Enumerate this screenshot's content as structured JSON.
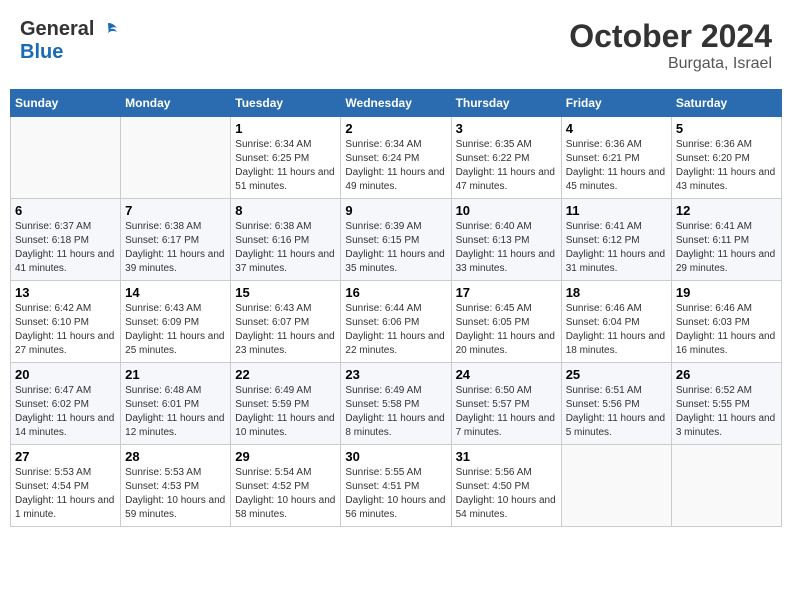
{
  "header": {
    "logo_general": "General",
    "logo_blue": "Blue",
    "month_title": "October 2024",
    "subtitle": "Burgata, Israel"
  },
  "days_of_week": [
    "Sunday",
    "Monday",
    "Tuesday",
    "Wednesday",
    "Thursday",
    "Friday",
    "Saturday"
  ],
  "weeks": [
    [
      {
        "day": "",
        "info": ""
      },
      {
        "day": "",
        "info": ""
      },
      {
        "day": "1",
        "info": "Sunrise: 6:34 AM\nSunset: 6:25 PM\nDaylight: 11 hours and 51 minutes."
      },
      {
        "day": "2",
        "info": "Sunrise: 6:34 AM\nSunset: 6:24 PM\nDaylight: 11 hours and 49 minutes."
      },
      {
        "day": "3",
        "info": "Sunrise: 6:35 AM\nSunset: 6:22 PM\nDaylight: 11 hours and 47 minutes."
      },
      {
        "day": "4",
        "info": "Sunrise: 6:36 AM\nSunset: 6:21 PM\nDaylight: 11 hours and 45 minutes."
      },
      {
        "day": "5",
        "info": "Sunrise: 6:36 AM\nSunset: 6:20 PM\nDaylight: 11 hours and 43 minutes."
      }
    ],
    [
      {
        "day": "6",
        "info": "Sunrise: 6:37 AM\nSunset: 6:18 PM\nDaylight: 11 hours and 41 minutes."
      },
      {
        "day": "7",
        "info": "Sunrise: 6:38 AM\nSunset: 6:17 PM\nDaylight: 11 hours and 39 minutes."
      },
      {
        "day": "8",
        "info": "Sunrise: 6:38 AM\nSunset: 6:16 PM\nDaylight: 11 hours and 37 minutes."
      },
      {
        "day": "9",
        "info": "Sunrise: 6:39 AM\nSunset: 6:15 PM\nDaylight: 11 hours and 35 minutes."
      },
      {
        "day": "10",
        "info": "Sunrise: 6:40 AM\nSunset: 6:13 PM\nDaylight: 11 hours and 33 minutes."
      },
      {
        "day": "11",
        "info": "Sunrise: 6:41 AM\nSunset: 6:12 PM\nDaylight: 11 hours and 31 minutes."
      },
      {
        "day": "12",
        "info": "Sunrise: 6:41 AM\nSunset: 6:11 PM\nDaylight: 11 hours and 29 minutes."
      }
    ],
    [
      {
        "day": "13",
        "info": "Sunrise: 6:42 AM\nSunset: 6:10 PM\nDaylight: 11 hours and 27 minutes."
      },
      {
        "day": "14",
        "info": "Sunrise: 6:43 AM\nSunset: 6:09 PM\nDaylight: 11 hours and 25 minutes."
      },
      {
        "day": "15",
        "info": "Sunrise: 6:43 AM\nSunset: 6:07 PM\nDaylight: 11 hours and 23 minutes."
      },
      {
        "day": "16",
        "info": "Sunrise: 6:44 AM\nSunset: 6:06 PM\nDaylight: 11 hours and 22 minutes."
      },
      {
        "day": "17",
        "info": "Sunrise: 6:45 AM\nSunset: 6:05 PM\nDaylight: 11 hours and 20 minutes."
      },
      {
        "day": "18",
        "info": "Sunrise: 6:46 AM\nSunset: 6:04 PM\nDaylight: 11 hours and 18 minutes."
      },
      {
        "day": "19",
        "info": "Sunrise: 6:46 AM\nSunset: 6:03 PM\nDaylight: 11 hours and 16 minutes."
      }
    ],
    [
      {
        "day": "20",
        "info": "Sunrise: 6:47 AM\nSunset: 6:02 PM\nDaylight: 11 hours and 14 minutes."
      },
      {
        "day": "21",
        "info": "Sunrise: 6:48 AM\nSunset: 6:01 PM\nDaylight: 11 hours and 12 minutes."
      },
      {
        "day": "22",
        "info": "Sunrise: 6:49 AM\nSunset: 5:59 PM\nDaylight: 11 hours and 10 minutes."
      },
      {
        "day": "23",
        "info": "Sunrise: 6:49 AM\nSunset: 5:58 PM\nDaylight: 11 hours and 8 minutes."
      },
      {
        "day": "24",
        "info": "Sunrise: 6:50 AM\nSunset: 5:57 PM\nDaylight: 11 hours and 7 minutes."
      },
      {
        "day": "25",
        "info": "Sunrise: 6:51 AM\nSunset: 5:56 PM\nDaylight: 11 hours and 5 minutes."
      },
      {
        "day": "26",
        "info": "Sunrise: 6:52 AM\nSunset: 5:55 PM\nDaylight: 11 hours and 3 minutes."
      }
    ],
    [
      {
        "day": "27",
        "info": "Sunrise: 5:53 AM\nSunset: 4:54 PM\nDaylight: 11 hours and 1 minute."
      },
      {
        "day": "28",
        "info": "Sunrise: 5:53 AM\nSunset: 4:53 PM\nDaylight: 10 hours and 59 minutes."
      },
      {
        "day": "29",
        "info": "Sunrise: 5:54 AM\nSunset: 4:52 PM\nDaylight: 10 hours and 58 minutes."
      },
      {
        "day": "30",
        "info": "Sunrise: 5:55 AM\nSunset: 4:51 PM\nDaylight: 10 hours and 56 minutes."
      },
      {
        "day": "31",
        "info": "Sunrise: 5:56 AM\nSunset: 4:50 PM\nDaylight: 10 hours and 54 minutes."
      },
      {
        "day": "",
        "info": ""
      },
      {
        "day": "",
        "info": ""
      }
    ]
  ]
}
